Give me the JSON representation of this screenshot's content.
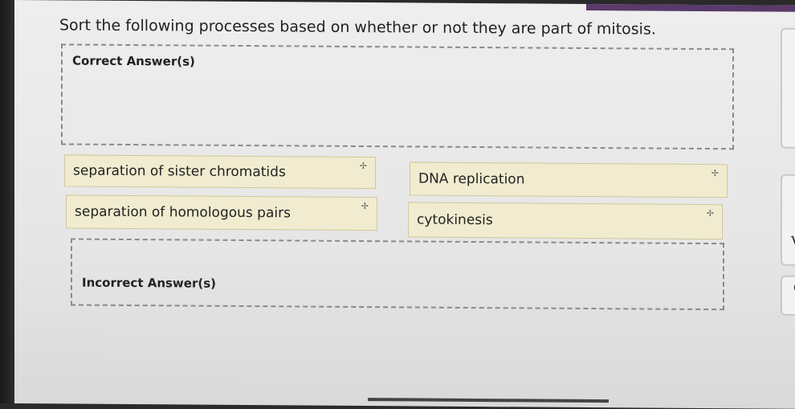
{
  "question": "Sort the following processes based on whether or not they are part of mitosis.",
  "correct_zone": {
    "title": "Correct Answer(s)"
  },
  "incorrect_zone": {
    "title": "Incorrect Answer(s)"
  },
  "cards": [
    {
      "label": "separation of sister chromatids"
    },
    {
      "label": "DNA replication"
    },
    {
      "label": "separation of homologous pairs"
    },
    {
      "label": "cytokinesis"
    }
  ],
  "drag_handle_glyph": "✢",
  "side": {
    "check": "√",
    "q": "Q"
  }
}
